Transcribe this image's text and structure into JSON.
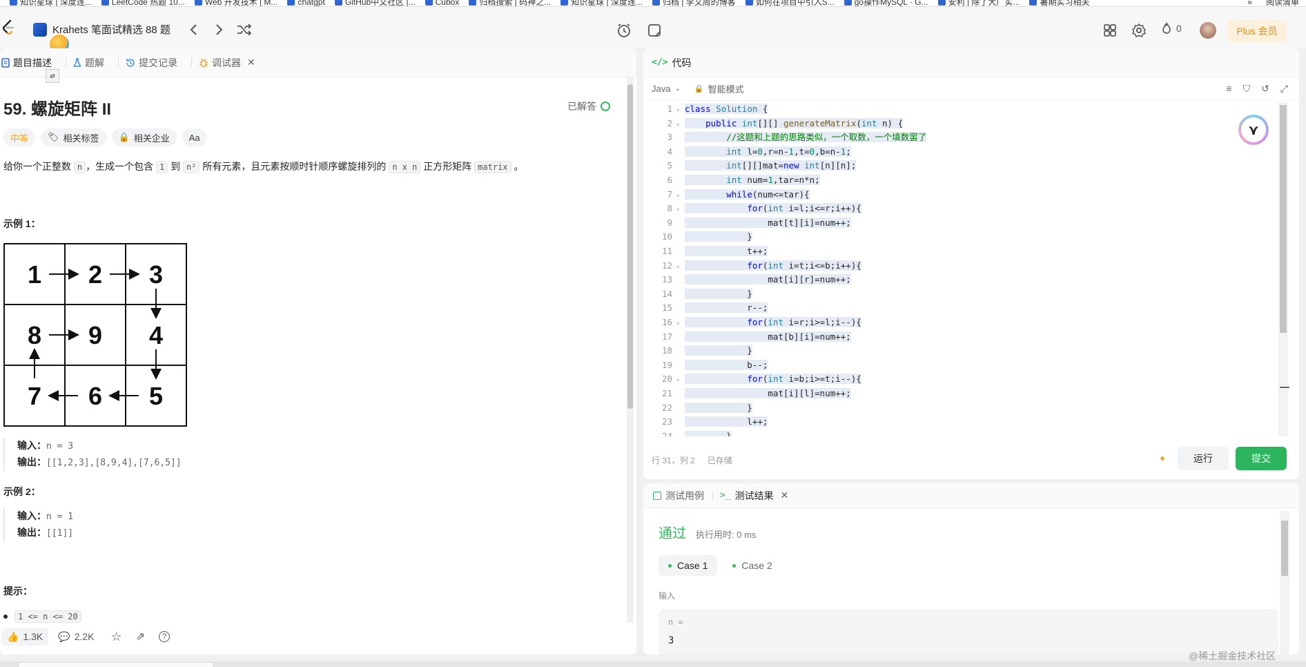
{
  "bookmarks": [
    "知识星球 | 深度连...",
    "LeetCode 热题 10...",
    "Web 开发技术 | M...",
    "chatgpt",
    "GitHub中文社区 |...",
    "Cubox",
    "归档搜索 | 码神之...",
    "知识星球 | 深度连...",
    "归档 | 李文周的博客",
    "如何在项目中引入S...",
    "go操作MySQL · G...",
    "安利 | 除了大厂实...",
    "暑期实习相关"
  ],
  "bookmarks_right": [
    "»",
    "阅读清单"
  ],
  "nav": {
    "study_plan": "Krahets 笔面试精选 88 题",
    "streak": "0",
    "plus": "Plus 会员"
  },
  "left_tabs": [
    "题目描述",
    "题解",
    "提交记录",
    "调试器"
  ],
  "problem": {
    "title": "59. 螺旋矩阵 II",
    "solved": "已解答",
    "tags": [
      "中等",
      "相关标签",
      "相关企业",
      "Aa"
    ],
    "statement_parts": [
      "给你一个正整数 ",
      "n",
      "，生成一个包含 ",
      "1",
      " 到 ",
      "n²",
      " 所有元素，且元素按顺时针顺序螺旋排列的 ",
      "n x n",
      " 正方形矩阵 ",
      "matrix",
      " 。"
    ],
    "example1_title": "示例 1：",
    "matrix": [
      [
        "1",
        "2",
        "3"
      ],
      [
        "8",
        "9",
        "4"
      ],
      [
        "7",
        "6",
        "5"
      ]
    ],
    "example1_input_label": "输入：",
    "example1_input": "n = 3",
    "example1_output_label": "输出：",
    "example1_output": "[[1,2,3],[8,9,4],[7,6,5]]",
    "example2_title": "示例 2：",
    "example2_input_label": "输入：",
    "example2_input": "n = 1",
    "example2_output_label": "输出：",
    "example2_output": "[[1]]",
    "hint_title": "提示：",
    "hint_1": "1 <= n <= 20"
  },
  "left_footer": {
    "likes": "1.3K",
    "comments": "2.2K"
  },
  "code": {
    "header": "代码",
    "header_icon": "</>",
    "language": "Java",
    "mode": "智能模式",
    "lines": [
      "class Solution {",
      "    public int[][] generateMatrix(int n) {",
      "        //这题和上题的思路类似，一个取数，一个填数罢了",
      "        int l=0,r=n-1,t=0,b=n-1;",
      "        int[][]mat=new int[n][n];",
      "        int num=1,tar=n*n;",
      "        while(num<=tar){",
      "            for(int i=l;i<=r;i++){",
      "                mat[t][i]=num++;",
      "            }",
      "            t++;",
      "            for(int i=t;i<=b;i++){",
      "                mat[i][r]=num++;",
      "            }",
      "            r--;",
      "            for(int i=r;i>=l;i--){",
      "                mat[b][i]=num++;",
      "            }",
      "            b--;",
      "            for(int i=b;i>=t;i--){",
      "                mat[i][l]=num++;",
      "            }",
      "            l++;",
      "        }"
    ],
    "foldable_lines": [
      1,
      2,
      7,
      8,
      12,
      16,
      20
    ],
    "cursor": "行 31，列 2",
    "saved": "已存储",
    "run": "运行",
    "submit": "提交"
  },
  "result": {
    "tabs": [
      "测试用例",
      "测试结果"
    ],
    "status": "通过",
    "runtime": "执行用时: 0 ms",
    "cases": [
      "Case 1",
      "Case 2"
    ],
    "input_label": "输入",
    "var_name": "n =",
    "var_value": "3"
  },
  "watermark": "@稀土掘金技术社区",
  "colors": {
    "accent_green": "#2cbb5d",
    "medium_orange": "#f5a623",
    "plus_orange": "#f08c00"
  }
}
